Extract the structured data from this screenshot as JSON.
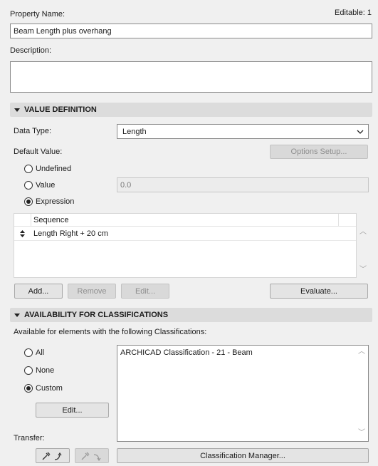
{
  "header": {
    "property_name_label": "Property Name:",
    "editable_label": "Editable: 1",
    "property_name_value": "Beam Length plus overhang",
    "description_label": "Description:",
    "description_value": ""
  },
  "value_definition": {
    "section_title": "VALUE DEFINITION",
    "data_type_label": "Data Type:",
    "data_type_value": "Length",
    "default_value_label": "Default Value:",
    "options_setup_label": "Options Setup...",
    "radios": [
      {
        "label": "Undefined",
        "selected": false
      },
      {
        "label": "Value",
        "selected": false
      },
      {
        "label": "Expression",
        "selected": true
      }
    ],
    "value_field": "0.0",
    "table": {
      "column_header": "Sequence",
      "rows": [
        "Length Right + 20 cm"
      ]
    },
    "buttons": {
      "add": "Add...",
      "remove": "Remove",
      "edit": "Edit...",
      "evaluate": "Evaluate..."
    }
  },
  "availability": {
    "section_title": "AVAILABILITY FOR CLASSIFICATIONS",
    "description": "Available for elements with the following Classifications:",
    "radios": [
      {
        "label": "All",
        "selected": false
      },
      {
        "label": "None",
        "selected": false
      },
      {
        "label": "Custom",
        "selected": true
      }
    ],
    "edit_button": "Edit...",
    "classifications": [
      "ARCHICAD Classification - 21 - Beam"
    ],
    "transfer_label": "Transfer:",
    "classification_manager_button": "Classification Manager...",
    "icons": [
      "eyedropper-get-icon",
      "eyedropper-inject-icon"
    ]
  }
}
